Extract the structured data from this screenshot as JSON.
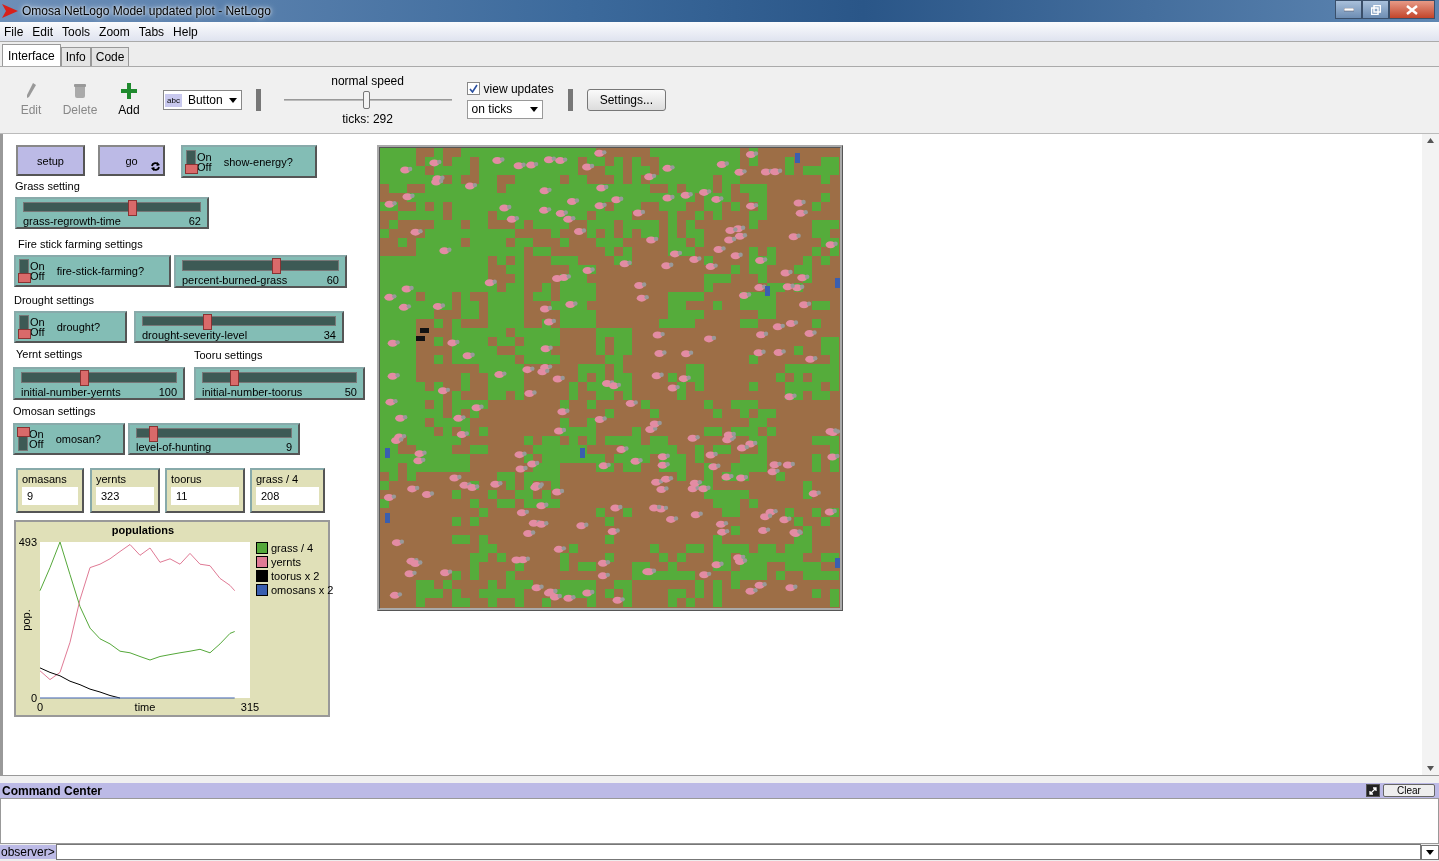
{
  "window": {
    "title": "Omosa NetLogo Model updated plot - NetLogo"
  },
  "menu": [
    "File",
    "Edit",
    "Tools",
    "Zoom",
    "Tabs",
    "Help"
  ],
  "tabs": [
    {
      "label": "Interface",
      "selected": true
    },
    {
      "label": "Info",
      "selected": false
    },
    {
      "label": "Code",
      "selected": false
    }
  ],
  "toolbar": {
    "tools": [
      {
        "kind": "edit",
        "label": "Edit",
        "disabled": true
      },
      {
        "kind": "delete",
        "label": "Delete",
        "disabled": true
      },
      {
        "kind": "add",
        "label": "Add",
        "disabled": false
      }
    ],
    "widget_type": "Button",
    "widget_type_icon": "abc",
    "speed": {
      "label": "normal speed",
      "level": 0.49,
      "ticks": "ticks: 292"
    },
    "view_updates": {
      "label": "view updates",
      "checked": true
    },
    "update_mode": "on ticks",
    "settings_button": "Settings..."
  },
  "widgets": [
    {
      "kind": "button",
      "label": "setup",
      "forever": false
    },
    {
      "kind": "button",
      "label": "go",
      "forever": true
    },
    {
      "kind": "switch",
      "label": "show-energy?",
      "on_label": "On",
      "off_label": "Off",
      "on": false
    },
    {
      "kind": "note",
      "text": "Grass setting"
    },
    {
      "kind": "slider",
      "label": "grass-regrowth-time",
      "value": "62",
      "level": 0.62
    },
    {
      "kind": "note",
      "text": "Fire stick farming settings"
    },
    {
      "kind": "switch",
      "label": "fire-stick-farming?",
      "on_label": "On",
      "off_label": "Off",
      "on": false
    },
    {
      "kind": "slider",
      "label": "percent-burned-grass",
      "value": "60",
      "level": 0.61
    },
    {
      "kind": "note",
      "text": "Drought settings"
    },
    {
      "kind": "switch",
      "label": "drought?",
      "on_label": "On",
      "off_label": "Off",
      "on": false
    },
    {
      "kind": "slider",
      "label": "drought-severity-level",
      "value": "34",
      "level": 0.33
    },
    {
      "kind": "note",
      "text": "Yernt settings"
    },
    {
      "kind": "note",
      "text": "Tooru settings"
    },
    {
      "kind": "slider",
      "label": "initial-number-yernts",
      "value": "100",
      "level": 0.4
    },
    {
      "kind": "slider",
      "label": "initial-number-toorus",
      "value": "50",
      "level": 0.19
    },
    {
      "kind": "note",
      "text": "Omosan settings"
    },
    {
      "kind": "switch",
      "label": "omosan?",
      "on_label": "On",
      "off_label": "Off",
      "on": true
    },
    {
      "kind": "slider",
      "label": "level-of-hunting",
      "value": "9",
      "level": 0.08
    },
    {
      "kind": "monitor",
      "label": "omasans",
      "value": "9"
    },
    {
      "kind": "monitor",
      "label": "yernts",
      "value": "323"
    },
    {
      "kind": "monitor",
      "label": "toorus",
      "value": "11"
    },
    {
      "kind": "monitor",
      "label": "grass / 4",
      "value": "208"
    },
    {
      "kind": "plot",
      "title": "populations",
      "chart_data": {
        "type": "line",
        "xlabel": "time",
        "ylabel": "pop.",
        "x": [
          0,
          15,
          30,
          45,
          60,
          75,
          90,
          105,
          120,
          135,
          150,
          165,
          180,
          195,
          210,
          225,
          240,
          255,
          270,
          285,
          292
        ],
        "xlim": [
          0,
          315
        ],
        "ylim": [
          0,
          493
        ],
        "xticks": [
          0,
          315
        ],
        "yticks": [
          0,
          493
        ],
        "legend": "right",
        "series": [
          {
            "name": "grass / 4",
            "color": "#55a83a",
            "values": [
              339,
              412,
              493,
              390,
              289,
              221,
              187,
              171,
              148,
              143,
              131,
              120,
              131,
              137,
              143,
              148,
              154,
              143,
              171,
              204,
              210
            ]
          },
          {
            "name": "yernts",
            "color": "#e07a95",
            "values": [
              86,
              58,
              81,
              176,
              311,
              412,
              423,
              440,
              463,
              485,
              451,
              474,
              429,
              440,
              423,
              457,
              423,
              418,
              378,
              356,
              339
            ]
          },
          {
            "name": "toorus x 2",
            "color": "#000000",
            "values": [
              95,
              81,
              70,
              53,
              42,
              28,
              19,
              8,
              0,
              null,
              null,
              null,
              null,
              null,
              null,
              null,
              null,
              null,
              null,
              null,
              null
            ]
          },
          {
            "name": "omosans x 2",
            "color": "#3a5fb0",
            "values": [
              0,
              0,
              0,
              0,
              0,
              0,
              0,
              0,
              0,
              0,
              0,
              0,
              0,
              0,
              0,
              0,
              0,
              0,
              0,
              0,
              0
            ]
          }
        ]
      }
    }
  ],
  "command_center": {
    "title": "Command Center",
    "clear_button": "Clear",
    "prompt": "observer>"
  }
}
